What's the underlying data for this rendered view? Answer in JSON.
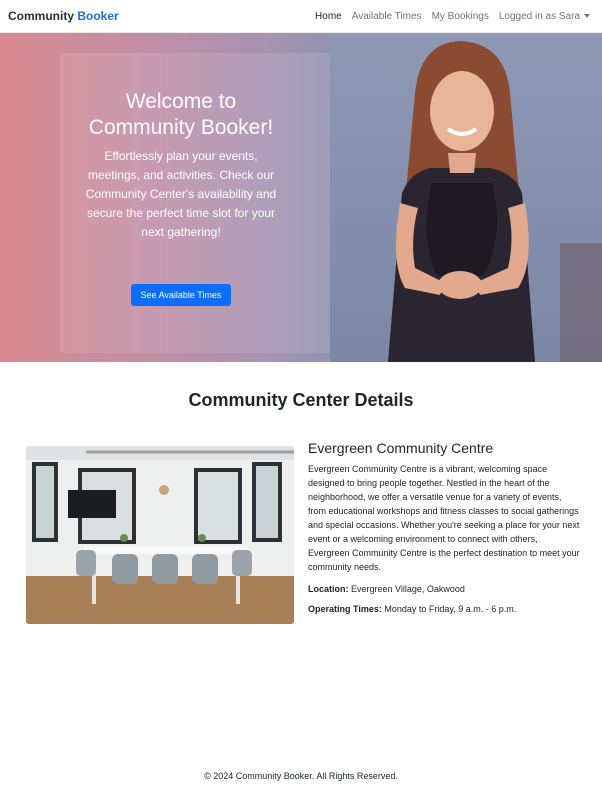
{
  "navbar": {
    "brand_part1": "Community",
    "brand_part2": "Booker",
    "links": [
      "Home",
      "Available Times",
      "My Bookings"
    ],
    "user_menu": "Logged in as Sara"
  },
  "hero": {
    "title": "Welcome to Community Booker!",
    "subtitle": "Effortlessly plan your events, meetings, and activities. Check our Community Center's availability and secure the perfect time slot for your next gathering!",
    "button": "See Available Times"
  },
  "details": {
    "section_title": "Community Center Details",
    "name": "Evergreen Community Centre",
    "description": "Evergreen Community Centre is a vibrant, welcoming space designed to bring people together. Nestled in the heart of the neighborhood, we offer a versatile venue for a variety of events, from educational workshops and fitness classes to social gatherings and special occasions. Whether you're seeking a place for your next event or a welcoming environment to connect with others, Evergreen Community Centre is the perfect destination to meet your community needs.",
    "location_label": "Location:",
    "location_value": "Evergreen Village, Oakwood",
    "hours_label": "Operating Times:",
    "hours_value": "Monday to Friday, 9 a.m. - 6 p.m."
  },
  "footer": {
    "text": "© 2024 Community Booker. All Rights Reserved."
  }
}
